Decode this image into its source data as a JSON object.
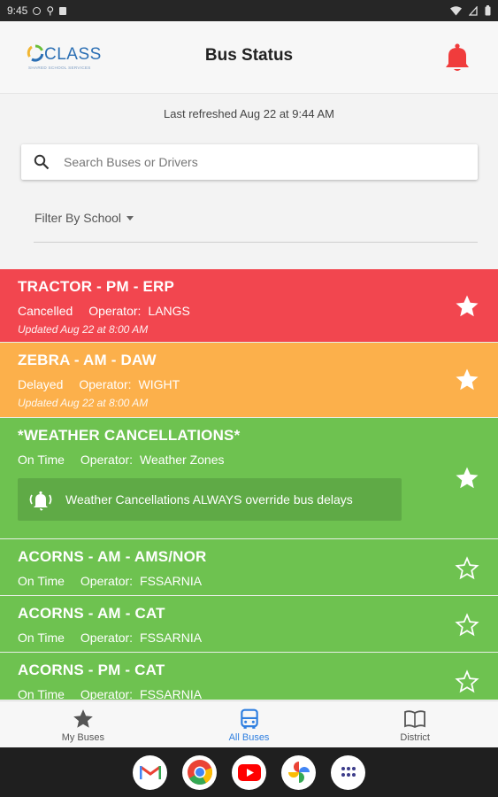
{
  "status_bar": {
    "time": "9:45"
  },
  "header": {
    "logo_text": "CLASS",
    "logo_subtitle": "SHARED SCHOOL SERVICES",
    "title": "Bus Status"
  },
  "refresh_text": "Last refreshed Aug 22 at 9:44 AM",
  "search": {
    "placeholder": "Search Buses or Drivers"
  },
  "filter": {
    "label": "Filter By School"
  },
  "colors": {
    "cancelled": "#f2464f",
    "delayed": "#fcb04b",
    "on_time": "#6ec250",
    "accent": "#2f7fe0"
  },
  "buses": [
    {
      "name": "TRACTOR - PM - ERP",
      "status": "Cancelled",
      "operator_label": "Operator:",
      "operator": "LANGS",
      "updated": "Updated Aug 22 at 8:00 AM",
      "favorite": true
    },
    {
      "name": "ZEBRA - AM - DAW",
      "status": "Delayed",
      "operator_label": "Operator:",
      "operator": "WIGHT",
      "updated": "Updated Aug 22 at 8:00 AM",
      "favorite": true
    },
    {
      "name": "*WEATHER CANCELLATIONS*",
      "status": "On Time",
      "operator_label": "Operator:",
      "operator": "Weather Zones",
      "note": "Weather Cancellations ALWAYS override bus delays",
      "favorite": true
    },
    {
      "name": "ACORNS - AM - AMS/NOR",
      "status": "On Time",
      "operator_label": "Operator:",
      "operator": "FSSARNIA",
      "favorite": false
    },
    {
      "name": "ACORNS - AM - CAT",
      "status": "On Time",
      "operator_label": "Operator:",
      "operator": "FSSARNIA",
      "favorite": false
    },
    {
      "name": "ACORNS - PM - CAT",
      "status": "On Time",
      "operator_label": "Operator:",
      "operator": "FSSARNIA",
      "favorite": false
    }
  ],
  "bottom_nav": [
    {
      "label": "My Buses",
      "icon": "star-icon",
      "active": false
    },
    {
      "label": "All Buses",
      "icon": "bus-icon",
      "active": true
    },
    {
      "label": "District",
      "icon": "book-icon",
      "active": false
    }
  ],
  "dock": [
    "gmail-icon",
    "chrome-icon",
    "youtube-icon",
    "photos-icon",
    "app-drawer-icon"
  ]
}
